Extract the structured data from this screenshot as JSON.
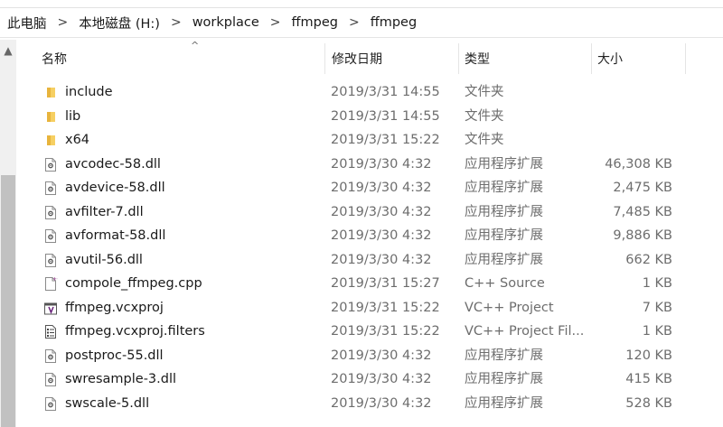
{
  "breadcrumb": [
    "此电脑",
    "本地磁盘 (H:)",
    "workplace",
    "ffmpeg",
    "ffmpeg"
  ],
  "header": {
    "name": "名称",
    "date": "修改日期",
    "type": "类型",
    "size": "大小"
  },
  "files": [
    {
      "name": "include",
      "date": "2019/3/31 14:55",
      "type": "文件夹",
      "size": "",
      "icon": "folder-icon"
    },
    {
      "name": "lib",
      "date": "2019/3/31 14:55",
      "type": "文件夹",
      "size": "",
      "icon": "folder-icon"
    },
    {
      "name": "x64",
      "date": "2019/3/31 15:22",
      "type": "文件夹",
      "size": "",
      "icon": "folder-icon"
    },
    {
      "name": "avcodec-58.dll",
      "date": "2019/3/30 4:32",
      "type": "应用程序扩展",
      "size": "46,308 KB",
      "icon": "dll-file-icon"
    },
    {
      "name": "avdevice-58.dll",
      "date": "2019/3/30 4:32",
      "type": "应用程序扩展",
      "size": "2,475 KB",
      "icon": "dll-file-icon"
    },
    {
      "name": "avfilter-7.dll",
      "date": "2019/3/30 4:32",
      "type": "应用程序扩展",
      "size": "7,485 KB",
      "icon": "dll-file-icon"
    },
    {
      "name": "avformat-58.dll",
      "date": "2019/3/30 4:32",
      "type": "应用程序扩展",
      "size": "9,886 KB",
      "icon": "dll-file-icon"
    },
    {
      "name": "avutil-56.dll",
      "date": "2019/3/30 4:32",
      "type": "应用程序扩展",
      "size": "662 KB",
      "icon": "dll-file-icon"
    },
    {
      "name": "compole_ffmpeg.cpp",
      "date": "2019/3/31 15:27",
      "type": "C++ Source",
      "size": "1 KB",
      "icon": "cpp-file-icon"
    },
    {
      "name": "ffmpeg.vcxproj",
      "date": "2019/3/31 15:22",
      "type": "VC++ Project",
      "size": "7 KB",
      "icon": "vcxproj-file-icon"
    },
    {
      "name": "ffmpeg.vcxproj.filters",
      "date": "2019/3/31 15:22",
      "type": "VC++ Project Fil...",
      "size": "1 KB",
      "icon": "filters-file-icon"
    },
    {
      "name": "postproc-55.dll",
      "date": "2019/3/30 4:32",
      "type": "应用程序扩展",
      "size": "120 KB",
      "icon": "dll-file-icon"
    },
    {
      "name": "swresample-3.dll",
      "date": "2019/3/30 4:32",
      "type": "应用程序扩展",
      "size": "415 KB",
      "icon": "dll-file-icon"
    },
    {
      "name": "swscale-5.dll",
      "date": "2019/3/30 4:32",
      "type": "应用程序扩展",
      "size": "528 KB",
      "icon": "dll-file-icon"
    }
  ]
}
